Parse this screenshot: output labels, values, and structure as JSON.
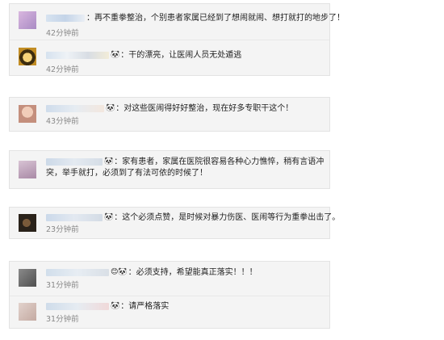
{
  "comments": [
    {
      "text": "：再不重拳整治，个别患者家属已经到了想闹就闹、想打就打的地步了！",
      "time": "42分钟前",
      "user_emoji": "",
      "avatar_color": "#c9a6cf"
    },
    {
      "text": "：干的漂亮，让医闹人员无处遁逃",
      "time": "42分钟前",
      "user_emoji": "🐼",
      "avatar_color": "#e7b53a"
    },
    {
      "text": "：对这些医闹得好好整治，现在好多专职干这个！",
      "time": "43分钟前",
      "user_emoji": "🐼",
      "avatar_color": "#d9a793"
    },
    {
      "text": "：家有患者，家属在医院很容易各种心力憔悴，稍有言语冲突，举手就打，必须到了有法可依的时候了！",
      "time": "",
      "user_emoji": "🐼",
      "avatar_color": "#b99ab5"
    },
    {
      "text": "：这个必须点赞，是时候对暴力伤医、医闹等行为重拳出击了。",
      "time": "23分钟前",
      "user_emoji": "🐼",
      "avatar_color": "#4b3b2b"
    },
    {
      "text": "：必须支持，希望能真正落实！！！",
      "time": "31分钟前",
      "user_emoji": "😊🐼",
      "avatar_color": "#6e6e6e"
    },
    {
      "text": "：请严格落实",
      "time": "31分钟前",
      "user_emoji": "🐼",
      "avatar_color": "#d9c4bd"
    }
  ]
}
